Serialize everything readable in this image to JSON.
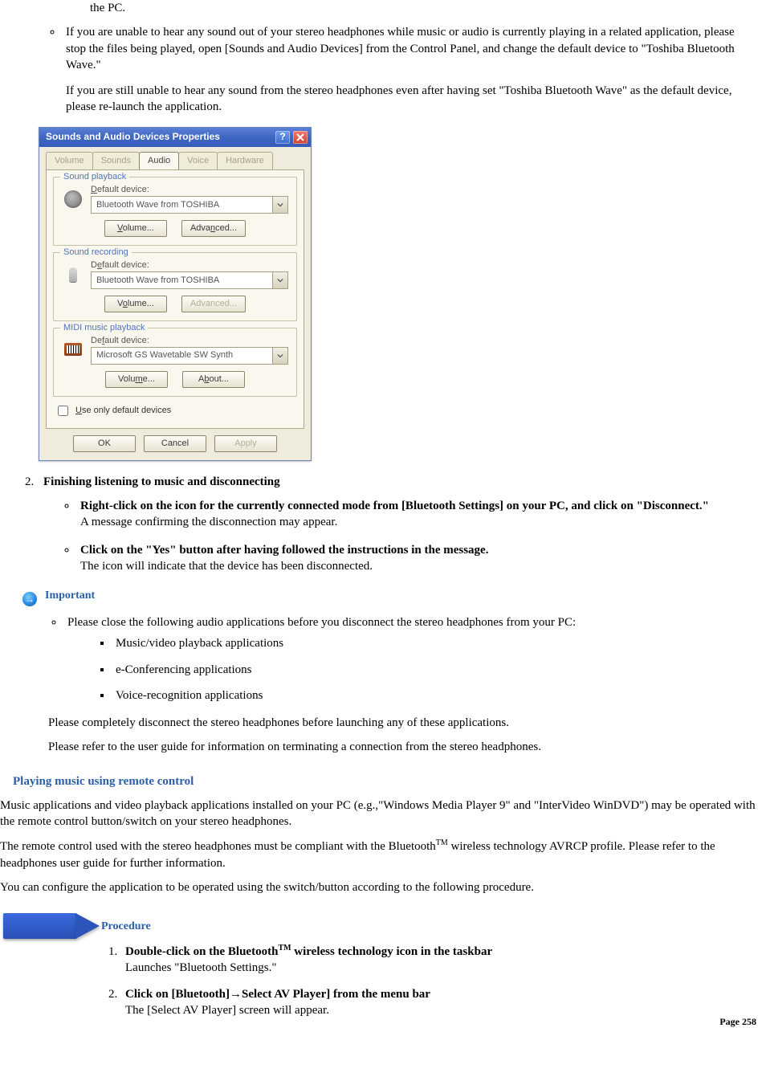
{
  "intro": {
    "lead_fragment": "the PC.",
    "bullet1_text": "If you are unable to hear any sound out of your stereo headphones while music or audio is currently playing in a related application, please stop the files being played, open [Sounds and Audio Devices] from the Control Panel, and change the default device to \"Toshiba Bluetooth Wave.\"",
    "bullet1_para2": "If you are still unable to hear any sound from the stereo headphones even after having set \"Toshiba Bluetooth Wave\" as the default device, please re-launch the application."
  },
  "dialog": {
    "title": "Sounds and Audio Devices Properties",
    "tabs": {
      "volume": "Volume",
      "sounds": "Sounds",
      "audio": "Audio",
      "voice": "Voice",
      "hardware": "Hardware"
    },
    "groups": {
      "playback": {
        "legend": "Sound playback",
        "label": "Default device:",
        "value": "Bluetooth Wave from TOSHIBA",
        "volume_btn": "Volume...",
        "advanced_btn": "Advanced..."
      },
      "recording": {
        "legend": "Sound recording",
        "label": "Default device:",
        "value": "Bluetooth Wave from TOSHIBA",
        "volume_btn": "Volume...",
        "advanced_btn": "Advanced..."
      },
      "midi": {
        "legend": "MIDI music playback",
        "label": "Default device:",
        "value": "Microsoft GS Wavetable SW Synth",
        "volume_btn": "Volume...",
        "about_btn": "About..."
      }
    },
    "only_default": "Use only default devices",
    "footer": {
      "ok": "OK",
      "cancel": "Cancel",
      "apply": "Apply"
    }
  },
  "finish": {
    "heading": "Finishing listening to music and disconnecting",
    "b1_strong": "Right-click on the icon for the currently connected mode from [Bluetooth Settings] on your PC, and click on \"Disconnect.\"",
    "b1_rest": "A message confirming the disconnection may appear.",
    "b2_strong": "Click on the \"Yes\" button after having followed the instructions in the message.",
    "b2_rest": "The icon will indicate that the device has been disconnected."
  },
  "important": {
    "label": "Important",
    "lead": "Please close the following audio applications before you disconnect the stereo headphones from your PC:",
    "items": {
      "a": "Music/video playback applications",
      "b": "e-Conferencing applications",
      "c": "Voice-recognition applications"
    },
    "p1": "Please completely disconnect the stereo headphones before launching any of these applications.",
    "p2": "Please refer to the user guide for information on terminating a connection from the stereo headphones."
  },
  "remote": {
    "heading": "Playing music using remote control",
    "p1": "Music applications and video playback applications installed on your PC (e.g.,\"Windows Media Player 9\" and \"InterVideo WinDVD\") may be operated with the remote control button/switch on your stereo headphones.",
    "p2a": "The remote control used with the stereo headphones must be compliant with the Bluetooth",
    "p2b": " wireless technology AVRCP profile. Please refer to the headphones user guide for further information.",
    "p3": "You can configure the application to be operated using the switch/button according to the following procedure."
  },
  "procedure": {
    "label": "Procedure",
    "s1_strong_a": "Double-click on the Bluetooth",
    "s1_strong_b": " wireless technology icon in the taskbar",
    "s1_rest": "Launches \"Bluetooth Settings.\"",
    "s2_strong": "Click on [Bluetooth]→Select AV Player] from the menu bar",
    "s2_rest": "The [Select AV Player] screen will appear."
  },
  "footer": {
    "page": "Page 258"
  }
}
